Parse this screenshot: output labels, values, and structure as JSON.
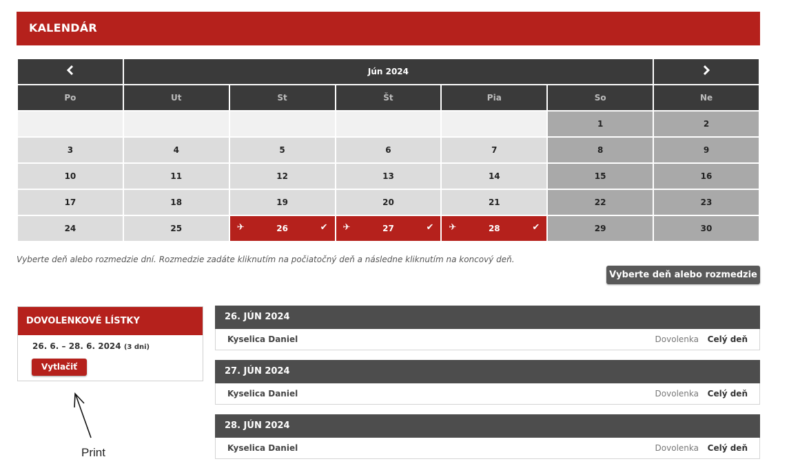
{
  "title": "KALENDÁR",
  "calendar": {
    "month": "Jún 2024",
    "prev_icon": "chevron-left-icon",
    "next_icon": "chevron-right-icon",
    "weekdays": [
      "Po",
      "Ut",
      "St",
      "Št",
      "Pia",
      "So",
      "Ne"
    ],
    "days": {
      "d1": "1",
      "d2": "2",
      "d3": "3",
      "d4": "4",
      "d5": "5",
      "d6": "6",
      "d7": "7",
      "d8": "8",
      "d9": "9",
      "d10": "10",
      "d11": "11",
      "d12": "12",
      "d13": "13",
      "d14": "14",
      "d15": "15",
      "d16": "16",
      "d17": "17",
      "d18": "18",
      "d19": "19",
      "d20": "20",
      "d21": "21",
      "d22": "22",
      "d23": "23",
      "d24": "24",
      "d25": "25",
      "d26": "26",
      "d27": "27",
      "d28": "28",
      "d29": "29",
      "d30": "30"
    },
    "selected_days": [
      "26",
      "27",
      "28"
    ],
    "selected_color": "#b5211c"
  },
  "hint": "Vyberte deň alebo rozmedzie dní. Rozmedzie zadáte kliknutím na počiatočný deň a následne kliknutím na koncový deň.",
  "select_button": "Vyberte deň alebo rozmedzie",
  "panel": {
    "title": "DOVOLENKOVÉ LÍSTKY",
    "range": "26. 6. – 28. 6. 2024",
    "range_days": "(3 dni)",
    "print_button": "Vytlačiť"
  },
  "annotation": "Print",
  "days_list": [
    {
      "date": "26. JÚN 2024",
      "name": "Kyselica Daniel",
      "type": "Dovolenka",
      "duration": "Celý deň"
    },
    {
      "date": "27. JÚN 2024",
      "name": "Kyselica Daniel",
      "type": "Dovolenka",
      "duration": "Celý deň"
    },
    {
      "date": "28. JÚN 2024",
      "name": "Kyselica Daniel",
      "type": "Dovolenka",
      "duration": "Celý deň"
    }
  ]
}
